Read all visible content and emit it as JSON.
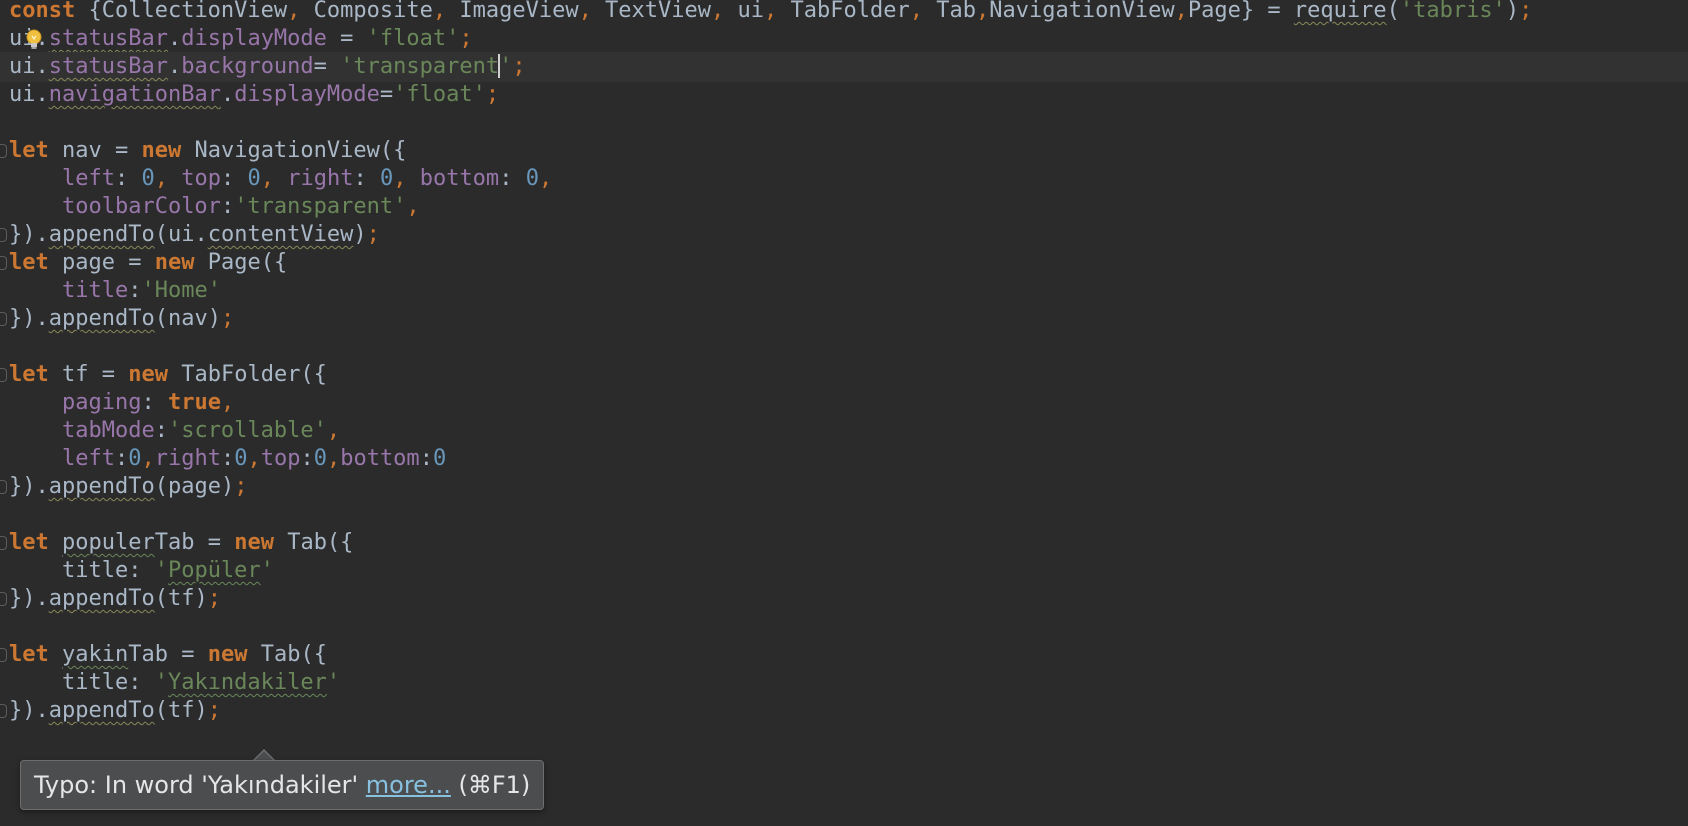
{
  "editor": {
    "language": "javascript",
    "cursor_line": 3,
    "lines": [
      "const {CollectionView, Composite, ImageView, TextView, ui, TabFolder, Tab,NavigationView,Page} = require('tabris');",
      "ui.statusBar.displayMode = 'float';",
      "ui.statusBar.background= 'transparent';",
      "ui.navigationBar.displayMode='float';",
      "",
      "let nav = new NavigationView({",
      "    left: 0, top: 0, right: 0, bottom: 0,",
      "    toolbarColor:'transparent',",
      "}).appendTo(ui.contentView);",
      "let page = new Page({",
      "    title:'Home'",
      "}).appendTo(nav);",
      "",
      "let tf = new TabFolder({",
      "    paging: true,",
      "    tabMode:'scrollable',",
      "    left:0,right:0,top:0,bottom:0",
      "}).appendTo(page);",
      "",
      "let populerTab = new Tab({",
      "    title: 'Popüler'",
      "}).appendTo(tf);",
      "",
      "let yakinTab = new Tab({",
      "    title: 'Yakındakiler'",
      "}).appendTo(tf);"
    ]
  },
  "tooltip": {
    "message": "Typo: In word 'Yakındakiler'",
    "link": "more...",
    "shortcut": "(⌘F1)"
  },
  "icons": {
    "intention": "lightbulb-icon"
  },
  "colors": {
    "background": "#2b2b2b",
    "keyword": "#cc7832",
    "property": "#9876aa",
    "string": "#6a8759",
    "number": "#6897bb",
    "text": "#a9b7c6",
    "tooltip_bg": "#4b4d4f"
  }
}
